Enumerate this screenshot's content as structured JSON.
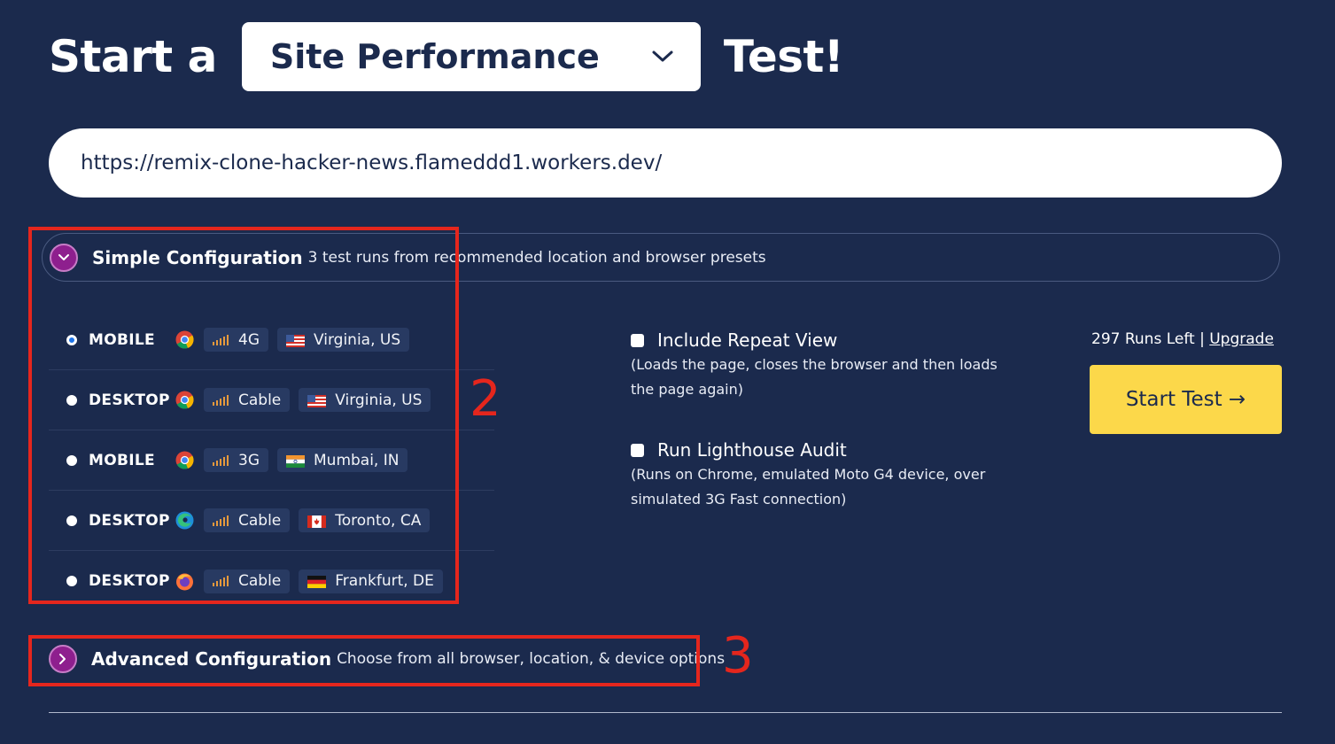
{
  "header": {
    "prefix": "Start a",
    "test_type": "Site Performance",
    "suffix": "Test!"
  },
  "url_input": {
    "value": "https://remix-clone-hacker-news.flameddd1.workers.dev/"
  },
  "simple_config": {
    "title": "Simple Configuration",
    "description": "3 test runs from recommended location and browser presets",
    "presets": [
      {
        "device": "MOBILE",
        "browser": "chrome-icon",
        "connection": "4G",
        "location": "Virginia, US",
        "flag": "us-flag-icon",
        "selected": true
      },
      {
        "device": "DESKTOP",
        "browser": "chrome-icon",
        "connection": "Cable",
        "location": "Virginia, US",
        "flag": "us-flag-icon",
        "selected": false
      },
      {
        "device": "MOBILE",
        "browser": "chrome-icon",
        "connection": "3G",
        "location": "Mumbai, IN",
        "flag": "in-flag-icon",
        "selected": false
      },
      {
        "device": "DESKTOP",
        "browser": "edge-icon",
        "connection": "Cable",
        "location": "Toronto, CA",
        "flag": "ca-flag-icon",
        "selected": false
      },
      {
        "device": "DESKTOP",
        "browser": "firefox-icon",
        "connection": "Cable",
        "location": "Frankfurt, DE",
        "flag": "de-flag-icon",
        "selected": false
      }
    ]
  },
  "options": {
    "repeat_view": {
      "label": "Include Repeat View",
      "description": "(Loads the page, closes the browser and then loads the page again)"
    },
    "lighthouse": {
      "label": "Run Lighthouse Audit",
      "description": "(Runs on Chrome, emulated Moto G4 device, over simulated 3G Fast connection)"
    }
  },
  "runs": {
    "text": "297 Runs Left |",
    "upgrade_label": "Upgrade"
  },
  "start_button": {
    "label": "Start Test →"
  },
  "advanced_config": {
    "title": "Advanced Configuration",
    "description": "Choose from all browser, location, & device options"
  },
  "annotations": {
    "label_2": "2",
    "label_3": "3",
    "color": "#e5261d"
  },
  "colors": {
    "background": "#1b2a4d",
    "accent_purple": "#8e1f8e",
    "start_button": "#fcd84a"
  }
}
